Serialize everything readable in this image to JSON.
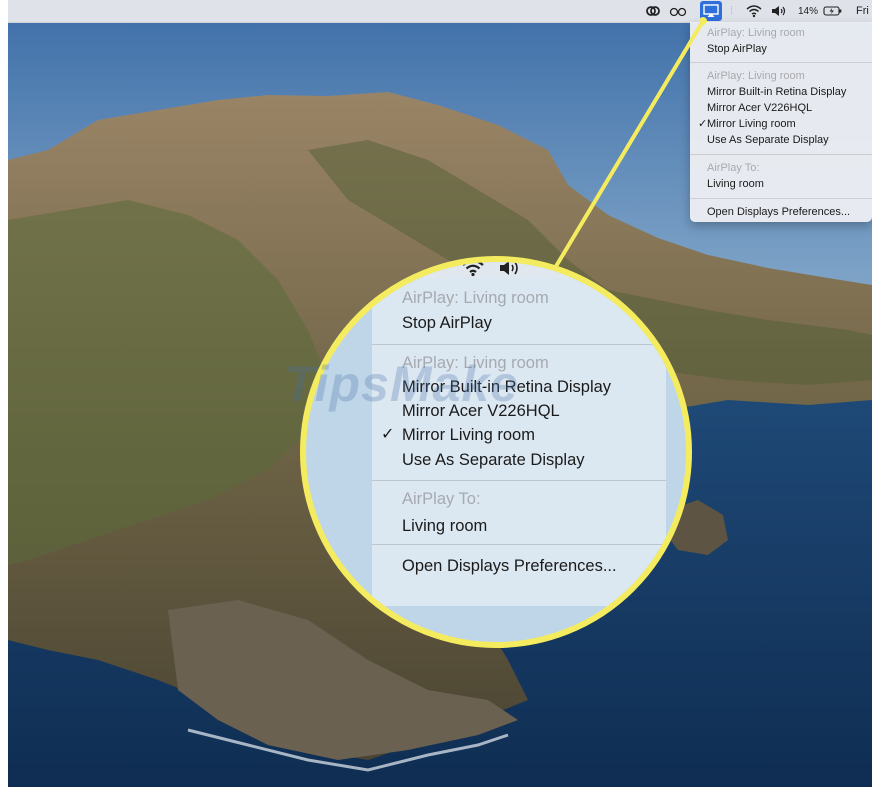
{
  "colors": {
    "accent_airplay": "#2f6fdc",
    "callout": "#f4ec5e",
    "menu_header": "#a9a9ad"
  },
  "menubar": {
    "icons": [
      "creative-cloud-icon",
      "glasses-icon",
      "airplay-icon",
      "wifi-icon",
      "volume-icon",
      "battery-icon"
    ],
    "battery_label": "14%",
    "day_label": "Fri"
  },
  "menu": {
    "header_current": "AirPlay: Living room",
    "stop": "Stop AirPlay",
    "header_mirror": "AirPlay: Living room",
    "mirror_builtin": "Mirror Built-in Retina Display",
    "mirror_acer": "Mirror Acer V226HQL",
    "mirror_living": "Mirror Living room",
    "separate": "Use As Separate Display",
    "header_to": "AirPlay To:",
    "living_room": "Living room",
    "open_prefs": "Open Displays Preferences...",
    "checked_item": "Mirror Living room",
    "check_mark": "✓"
  },
  "watermark": "TipsMake"
}
